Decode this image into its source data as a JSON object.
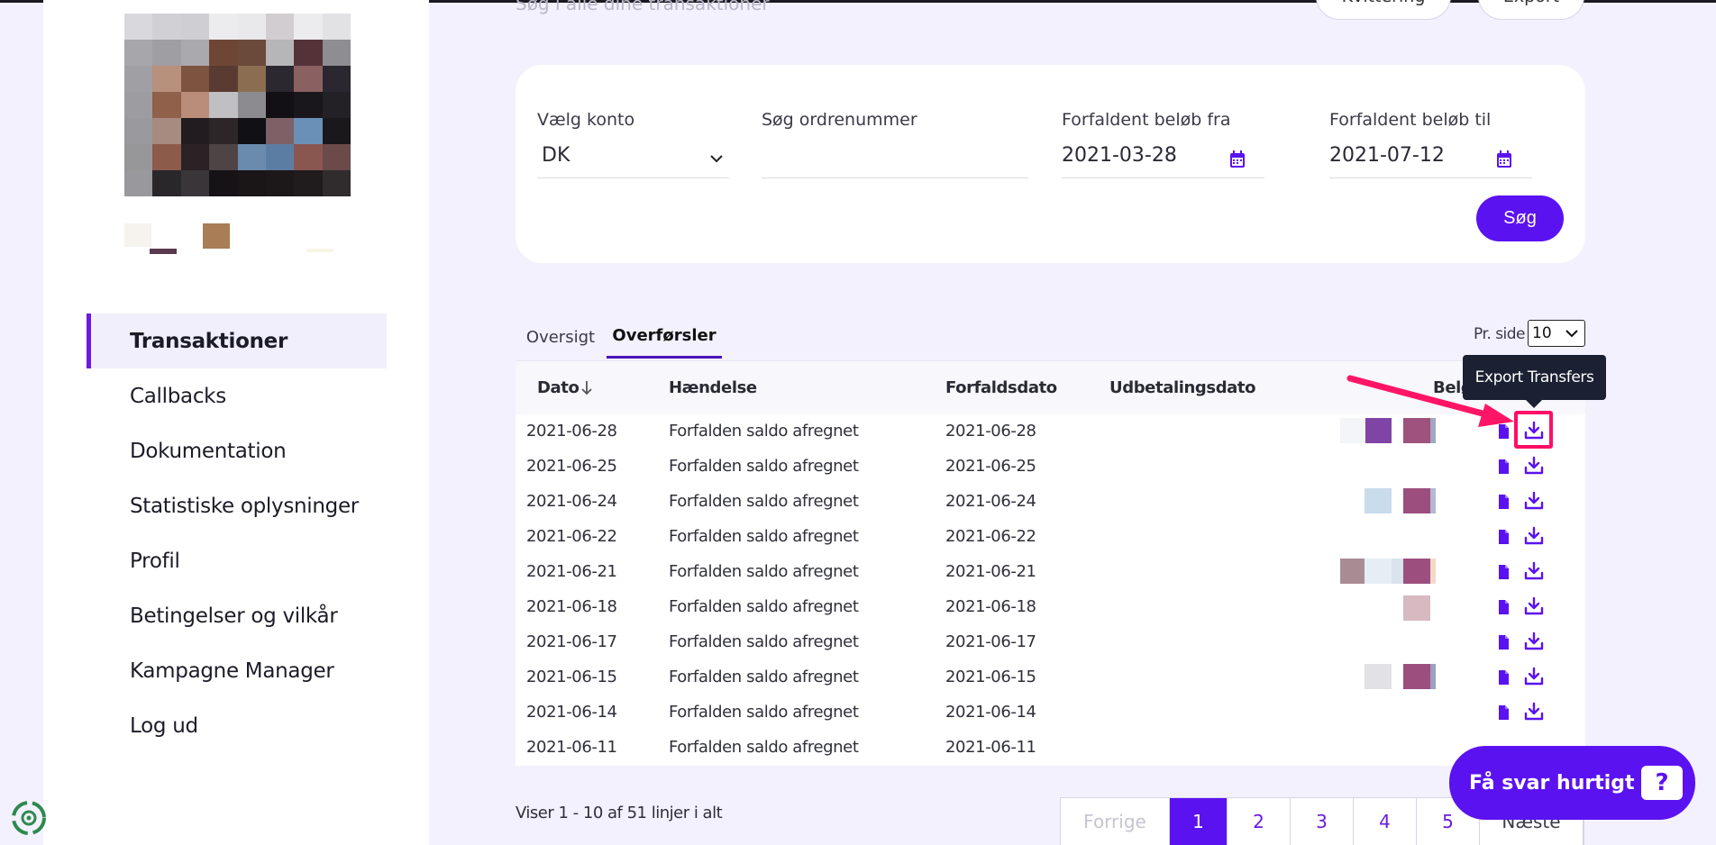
{
  "top": {
    "search_hint": "Søg i alle dine transaktioner",
    "kvittering_label": "Kvittering",
    "export_label": "Export"
  },
  "sidebar": {
    "items": [
      {
        "label": "Transaktioner",
        "active": true
      },
      {
        "label": "Callbacks"
      },
      {
        "label": "Dokumentation"
      },
      {
        "label": "Statistiske oplysninger"
      },
      {
        "label": "Profil"
      },
      {
        "label": "Betingelser og vilkår"
      },
      {
        "label": "Kampagne Manager"
      },
      {
        "label": "Log ud"
      }
    ]
  },
  "filters": {
    "account_label": "Vælg konto",
    "account_value": "DK",
    "order_label": "Søg ordrenummer",
    "order_value": "",
    "from_label": "Forfaldent beløb fra",
    "from_value": "2021-03-28",
    "to_label": "Forfaldent beløb til",
    "to_value": "2021-07-12",
    "search_button": "Søg"
  },
  "tabs": [
    {
      "label": "Oversigt",
      "active": false
    },
    {
      "label": "Overførsler",
      "active": true
    }
  ],
  "per_side": {
    "label": "Pr. side",
    "value": "10"
  },
  "table": {
    "headers": {
      "date": "Dato",
      "event": "Hændelse",
      "due": "Forfaldsdato",
      "payout": "Udbetalingsdato",
      "amount": "Beløb"
    },
    "sort_icon": "arrow-down-icon",
    "rows": [
      {
        "date": "2021-06-28",
        "event": "Forfalden saldo afregnet",
        "due": "2021-06-28"
      },
      {
        "date": "2021-06-25",
        "event": "Forfalden saldo afregnet",
        "due": "2021-06-25"
      },
      {
        "date": "2021-06-24",
        "event": "Forfalden saldo afregnet",
        "due": "2021-06-24"
      },
      {
        "date": "2021-06-22",
        "event": "Forfalden saldo afregnet",
        "due": "2021-06-22"
      },
      {
        "date": "2021-06-21",
        "event": "Forfalden saldo afregnet",
        "due": "2021-06-21"
      },
      {
        "date": "2021-06-18",
        "event": "Forfalden saldo afregnet",
        "due": "2021-06-18"
      },
      {
        "date": "2021-06-17",
        "event": "Forfalden saldo afregnet",
        "due": "2021-06-17"
      },
      {
        "date": "2021-06-15",
        "event": "Forfalden saldo afregnet",
        "due": "2021-06-15"
      },
      {
        "date": "2021-06-14",
        "event": "Forfalden saldo afregnet",
        "due": "2021-06-14"
      },
      {
        "date": "2021-06-11",
        "event": "Forfalden saldo afregnet",
        "due": "2021-06-11"
      }
    ]
  },
  "tooltip": {
    "text": "Export Transfers"
  },
  "footer": {
    "summary": "Viser 1 - 10 af 51 linjer i alt"
  },
  "pager": {
    "prev": "Forrige",
    "pages": [
      "1",
      "2",
      "3",
      "4",
      "5"
    ],
    "next": "Næste",
    "active": "1"
  },
  "help": {
    "label": "Få svar hurtigt",
    "icon_text": "?"
  },
  "colors": {
    "accent": "#5b12f0",
    "highlight": "#ff0d66",
    "tooltip_bg": "#1c2033"
  }
}
